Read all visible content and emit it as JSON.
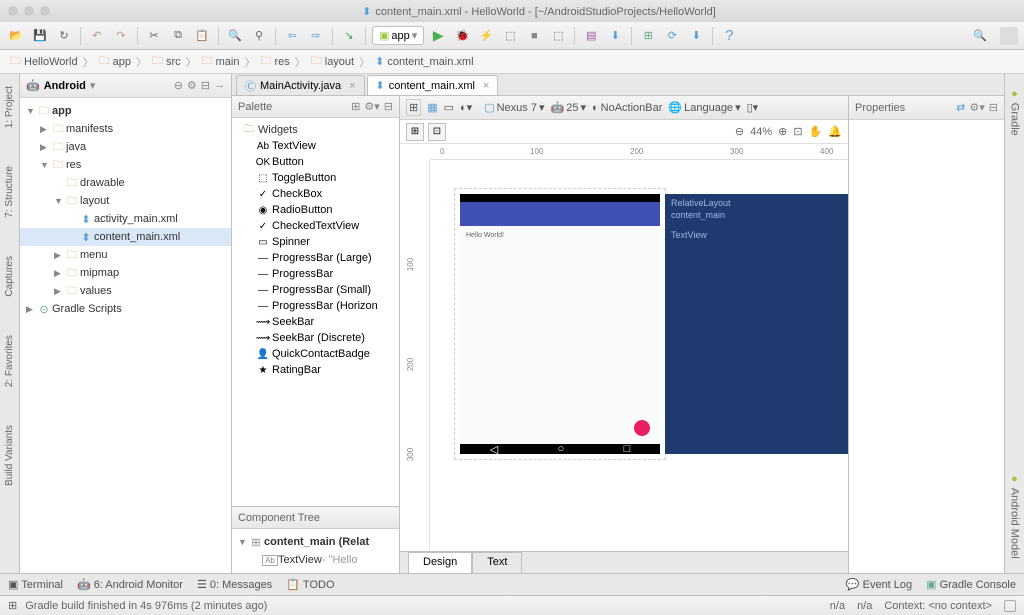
{
  "window": {
    "title": "content_main.xml - HelloWorld - [~/AndroidStudioProjects/HelloWorld]"
  },
  "breadcrumb": [
    "HelloWorld",
    "app",
    "src",
    "main",
    "res",
    "layout",
    "content_main.xml"
  ],
  "app_selector": "app",
  "left_tabs": [
    "1: Project",
    "7: Structure",
    "Captures",
    "2: Favorites",
    "Build Variants"
  ],
  "right_tabs": [
    "Gradle",
    "Android Model"
  ],
  "project_view": "Android",
  "tree": {
    "root": "app",
    "children": [
      "manifests",
      "java",
      "res"
    ],
    "res": [
      "drawable",
      "layout",
      "menu",
      "mipmap",
      "values"
    ],
    "layout": [
      "activity_main.xml",
      "content_main.xml"
    ],
    "gradle": "Gradle Scripts"
  },
  "editor_tabs": [
    {
      "label": "MainActivity.java",
      "icon": "C",
      "active": false
    },
    {
      "label": "content_main.xml",
      "icon": "⬍",
      "active": true
    }
  ],
  "palette": {
    "title": "Palette",
    "group": "Widgets",
    "items": [
      "TextView",
      "Button",
      "ToggleButton",
      "CheckBox",
      "RadioButton",
      "CheckedTextView",
      "Spinner",
      "ProgressBar (Large)",
      "ProgressBar",
      "ProgressBar (Small)",
      "ProgressBar (Horizon",
      "SeekBar",
      "SeekBar (Discrete)",
      "QuickContactBadge",
      "RatingBar"
    ]
  },
  "palette_icons": [
    "Ab",
    "OK",
    "⬚",
    "✓",
    "◉",
    "✓",
    "▭",
    "—",
    "—",
    "—",
    "—",
    "⟿",
    "⟿",
    "👤",
    "★"
  ],
  "component_tree": {
    "title": "Component Tree",
    "root": "content_main (Relat",
    "child": "TextView",
    "childText": " - \"Hello"
  },
  "design_toolbar": {
    "device": "Nexus 7",
    "api": "25",
    "theme": "NoActionBar",
    "lang": "Language"
  },
  "zoom": "44%",
  "ruler_h": [
    "0",
    "100",
    "200",
    "300",
    "400"
  ],
  "ruler_v": [
    "100",
    "200",
    "300"
  ],
  "preview_text": "Hello World!",
  "blueprint": {
    "r1": "RelativeLayout",
    "r2": "content_main",
    "r3": "TextView"
  },
  "design_tabs": {
    "design": "Design",
    "text": "Text"
  },
  "props": {
    "title": "Properties"
  },
  "bottom_tabs": {
    "terminal": "Terminal",
    "monitor": "6: Android Monitor",
    "messages": "0: Messages",
    "todo": "TODO",
    "eventlog": "Event Log",
    "gradle": "Gradle Console"
  },
  "status": {
    "msg": "Gradle build finished in 4s 976ms (2 minutes ago)",
    "na1": "n/a",
    "na2": "n/a",
    "ctx": "Context: <no context>"
  }
}
